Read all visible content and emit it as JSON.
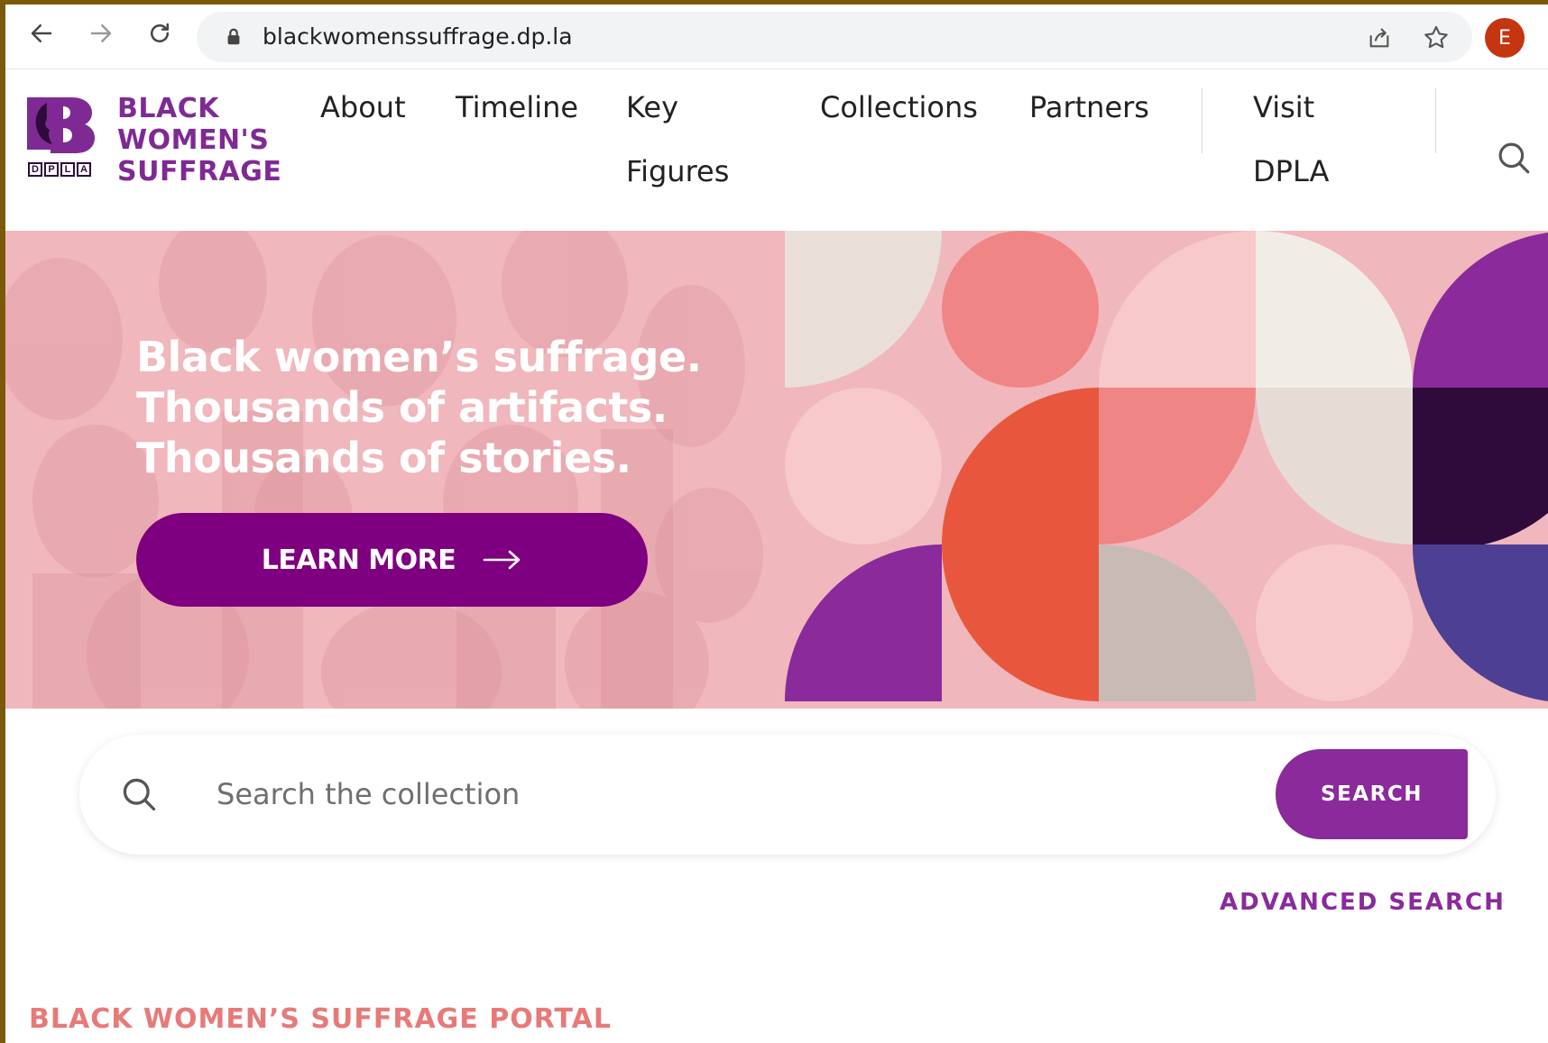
{
  "browser": {
    "url": "blackwomenssuffrage.dp.la",
    "profile_initial": "E",
    "icons": [
      "back-arrow-icon",
      "forward-arrow-icon",
      "reload-icon",
      "lock-icon",
      "share-icon",
      "star-icon"
    ]
  },
  "logo": {
    "line1": "BLACK",
    "line2": "WOMEN'S",
    "line3": "SUFFRAGE",
    "dpla": [
      "D",
      "P",
      "L",
      "A"
    ]
  },
  "nav": {
    "about": "About",
    "timeline": "Timeline",
    "key_figures_1": "Key",
    "key_figures_2": "Figures",
    "collections": "Collections",
    "partners": "Partners",
    "visit_1": "Visit",
    "visit_2": "DPLA"
  },
  "hero": {
    "line1": "Black women’s suffrage.",
    "line2": "Thousands of artifacts.",
    "line3": "Thousands of stories.",
    "cta": "LEARN MORE"
  },
  "search": {
    "placeholder": "Search the collection",
    "button": "SEARCH",
    "advanced": "ADVANCED SEARCH"
  },
  "section": {
    "title": "BLACK WOMEN’S SUFFRAGE PORTAL"
  },
  "colors": {
    "brand_purple": "#8a2a9b",
    "cta_purple": "#7e0080",
    "hero_pink": "#f0b7bc",
    "coral": "#e77a79"
  }
}
